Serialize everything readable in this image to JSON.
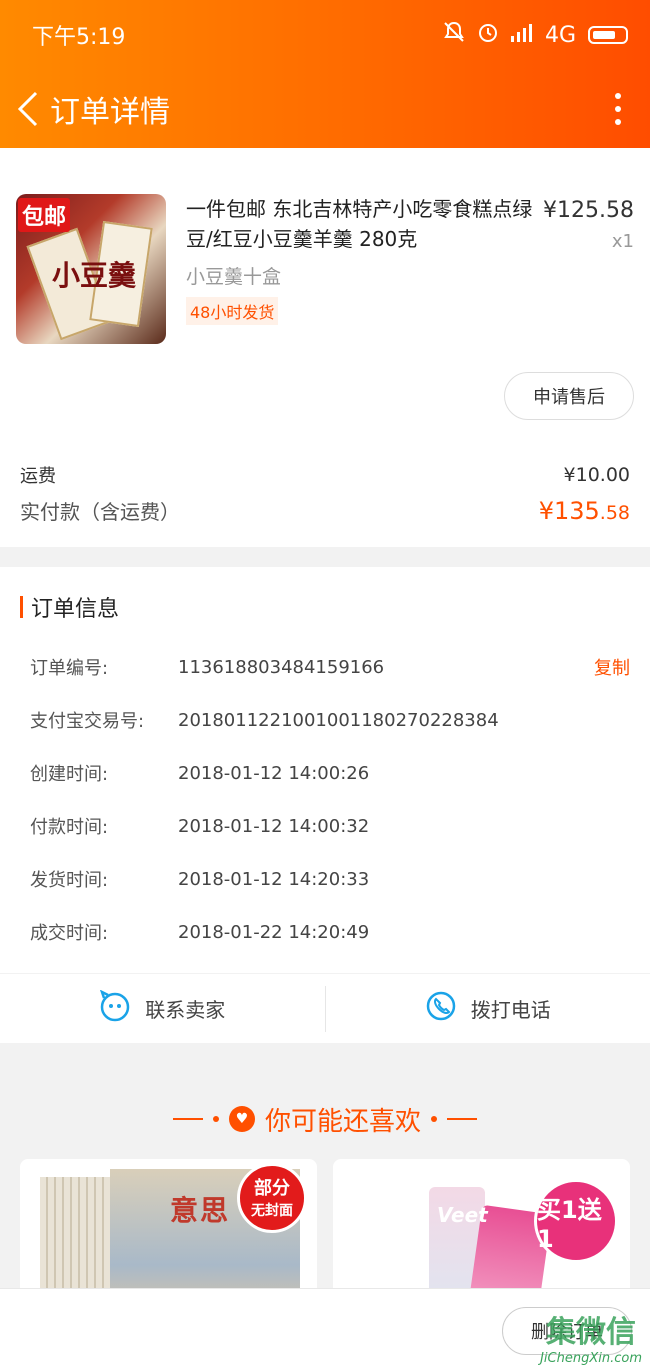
{
  "status_bar": {
    "time": "下午5:19",
    "network": "4G"
  },
  "header": {
    "title": "订单详情"
  },
  "product": {
    "name": "一件包邮 东北吉林特产小吃零食糕点绿豆/红豆小豆羹羊羹 280克",
    "spec": "小豆羹十盒",
    "badge": "48小时发货",
    "price": "¥125.58",
    "qty": "x1",
    "image_tag": "包邮",
    "image_text": "小豆羹"
  },
  "after_sale_button": "申请售后",
  "fees": {
    "shipping_label": "运费",
    "shipping_value": "¥10.00",
    "total_label": "实付款（含运费）",
    "total_currency": "¥",
    "total_int": "135",
    "total_dec": ".58"
  },
  "order_info": {
    "title": "订单信息",
    "copy_label": "复制",
    "rows": [
      {
        "key": "订单编号:",
        "value": "113618803484159166"
      },
      {
        "key": "支付宝交易号:",
        "value": "2018011221001001180270228384"
      },
      {
        "key": "创建时间:",
        "value": "2018-01-12 14:00:26"
      },
      {
        "key": "付款时间:",
        "value": "2018-01-12 14:00:32"
      },
      {
        "key": "发货时间:",
        "value": "2018-01-12 14:20:33"
      },
      {
        "key": "成交时间:",
        "value": "2018-01-22 14:20:49"
      }
    ]
  },
  "contact": {
    "seller": "联系卖家",
    "phone": "拨打电话"
  },
  "recommend": {
    "title": "你可能还喜欢",
    "item1_badge_line1": "部分",
    "item1_badge_line2": "无封面",
    "item1_cover_title": "意思",
    "item2_badge": "买1送1",
    "item2_brand": "Veet"
  },
  "bottom": {
    "delete_button": "删除订单"
  },
  "watermark": {
    "main": "集微信",
    "sub": "JiChengXin.com"
  },
  "colors": {
    "accent": "#ff5000",
    "header_start": "#ff8a00",
    "header_end": "#ff4d00"
  }
}
